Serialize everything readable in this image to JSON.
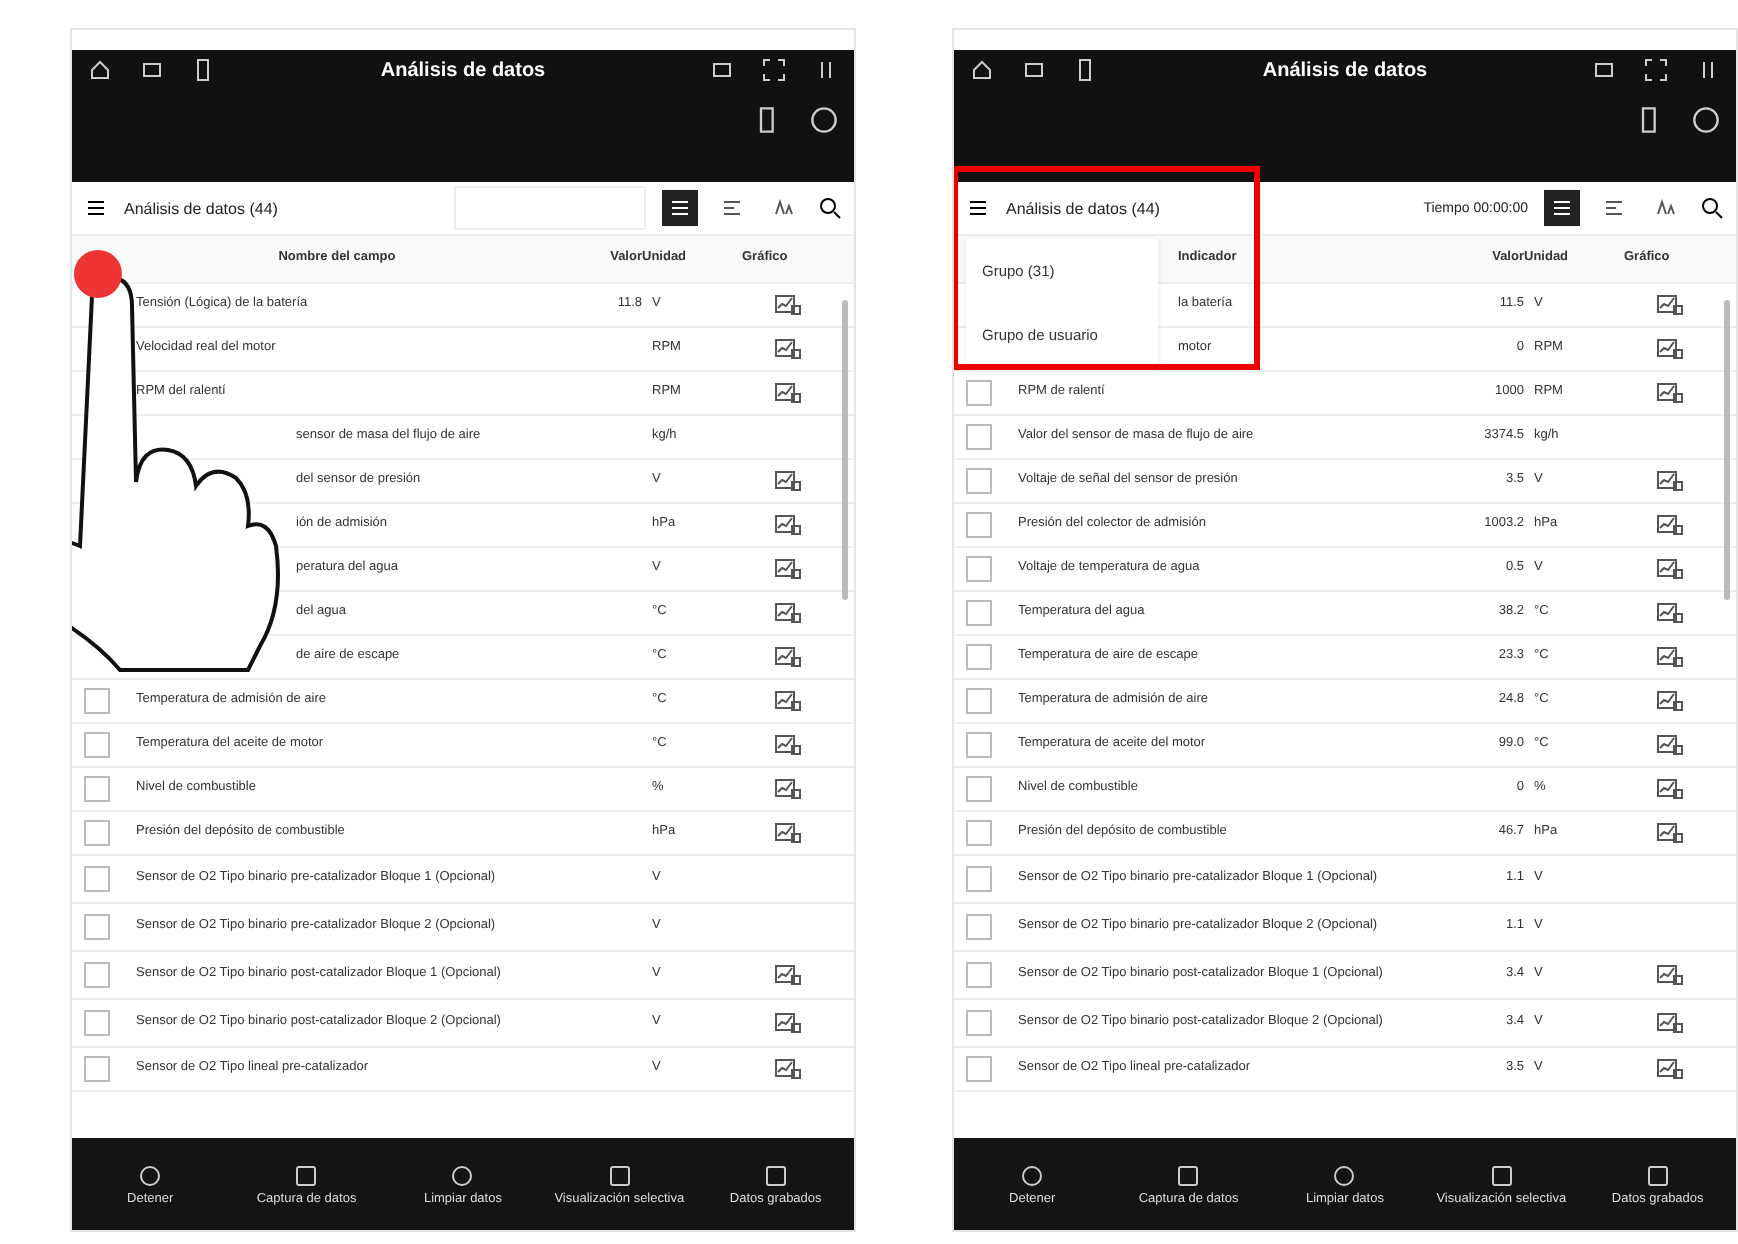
{
  "screens": [
    {
      "title": "Análisis de datos",
      "hand": true,
      "toolbar": {
        "label": "Análisis de datos (44)"
      },
      "columns": [
        "Nombre del campo",
        "Valor",
        "Unidad",
        "Gráfico"
      ],
      "rows": [
        {
          "name": "Tensión (Lógica) de la batería",
          "value": "11.8",
          "unit": "V",
          "graph": true
        },
        {
          "name": "Velocidad real del motor",
          "value": "",
          "unit": "RPM",
          "graph": true
        },
        {
          "name": "RPM del ralentí",
          "value": "",
          "unit": "RPM",
          "graph": true
        },
        {
          "name": "sensor de masa del flujo de aire",
          "value": "",
          "unit": "kg/h",
          "graph": false
        },
        {
          "name": "del sensor de presión",
          "value": "",
          "unit": "V",
          "graph": true
        },
        {
          "name": "ión de admisión",
          "value": "",
          "unit": "hPa",
          "graph": true
        },
        {
          "name": "peratura del agua",
          "value": "",
          "unit": "V",
          "graph": true
        },
        {
          "name": "del agua",
          "value": "",
          "unit": "°C",
          "graph": true
        },
        {
          "name": "de aire de escape",
          "value": "",
          "unit": "°C",
          "graph": true
        },
        {
          "name": "Temperatura de admisión de aire",
          "value": "",
          "unit": "°C",
          "graph": true,
          "checked": false
        },
        {
          "name": "Temperatura del aceite de motor",
          "value": "",
          "unit": "°C",
          "graph": true,
          "checked": false
        },
        {
          "name": "Nivel de combustible",
          "value": "",
          "unit": "%",
          "graph": true,
          "checked": false
        },
        {
          "name": "Presión del depósito de combustible",
          "value": "",
          "unit": "hPa",
          "graph": true,
          "checked": false
        },
        {
          "name": "Sensor de O2 Tipo binario pre-catalizador Bloque 1 (Opcional)",
          "value": "",
          "unit": "V",
          "graph": false,
          "checked": false
        },
        {
          "name": "Sensor de O2 Tipo binario pre-catalizador Bloque 2 (Opcional)",
          "value": "",
          "unit": "V",
          "graph": false,
          "checked": false
        },
        {
          "name": "Sensor de O2 Tipo binario post-catalizador Bloque 1 (Opcional)",
          "value": "",
          "unit": "V",
          "graph": true,
          "checked": false
        },
        {
          "name": "Sensor de O2 Tipo binario post-catalizador Bloque 2 (Opcional)",
          "value": "",
          "unit": "V",
          "graph": true,
          "checked": false
        },
        {
          "name": "Sensor de O2 Tipo lineal pre-catalizador",
          "value": "",
          "unit": "V",
          "graph": true,
          "checked": false
        }
      ],
      "buttons": [
        "Detener",
        "Captura de datos",
        "Limpiar datos",
        "Visualización selectiva",
        "Datos grabados"
      ]
    },
    {
      "title": "Análisis de datos",
      "hand": false,
      "toolbar": {
        "label": "Análisis de datos (44)",
        "time": "Tiempo 00:00:00"
      },
      "group_menu": {
        "items": [
          "Grupo (31)",
          "Grupo de usuario"
        ],
        "highlighted": true
      },
      "columns": [
        "Indicador",
        "Valor",
        "Unidad",
        "Gráfico"
      ],
      "rows": [
        {
          "name": "la batería",
          "value": "11.5",
          "unit": "V",
          "graph": true
        },
        {
          "name": "motor",
          "value": "0",
          "unit": "RPM",
          "graph": true
        },
        {
          "name": "RPM de ralentí",
          "value": "1000",
          "unit": "RPM",
          "graph": true,
          "checked": false
        },
        {
          "name": "Valor del sensor de masa de flujo de aire",
          "value": "3374.5",
          "unit": "kg/h",
          "graph": false,
          "checked": false
        },
        {
          "name": "Voltaje de señal del sensor de presión",
          "value": "3.5",
          "unit": "V",
          "graph": true,
          "checked": false
        },
        {
          "name": "Presión del colector de admisión",
          "value": "1003.2",
          "unit": "hPa",
          "graph": true,
          "checked": false
        },
        {
          "name": "Voltaje de temperatura de agua",
          "value": "0.5",
          "unit": "V",
          "graph": true,
          "checked": false
        },
        {
          "name": "Temperatura del agua",
          "value": "38.2",
          "unit": "°C",
          "graph": true,
          "checked": false
        },
        {
          "name": "Temperatura de aire de escape",
          "value": "23.3",
          "unit": "°C",
          "graph": true,
          "checked": false
        },
        {
          "name": "Temperatura de admisión de aire",
          "value": "24.8",
          "unit": "°C",
          "graph": true,
          "checked": false
        },
        {
          "name": "Temperatura de aceite del motor",
          "value": "99.0",
          "unit": "°C",
          "graph": true,
          "checked": false
        },
        {
          "name": "Nivel de combustible",
          "value": "0",
          "unit": "%",
          "graph": true,
          "checked": false
        },
        {
          "name": "Presión del depósito de combustible",
          "value": "46.7",
          "unit": "hPa",
          "graph": true,
          "checked": false
        },
        {
          "name": "Sensor de O2 Tipo binario pre-catalizador Bloque 1 (Opcional)",
          "value": "1.1",
          "unit": "V",
          "graph": false,
          "checked": false
        },
        {
          "name": "Sensor de O2 Tipo binario pre-catalizador Bloque 2 (Opcional)",
          "value": "1.1",
          "unit": "V",
          "graph": false,
          "checked": false
        },
        {
          "name": "Sensor de O2 Tipo binario post-catalizador Bloque 1 (Opcional)",
          "value": "3.4",
          "unit": "V",
          "graph": true,
          "checked": false
        },
        {
          "name": "Sensor de O2 Tipo binario post-catalizador Bloque 2 (Opcional)",
          "value": "3.4",
          "unit": "V",
          "graph": true,
          "checked": false
        },
        {
          "name": "Sensor de O2 Tipo lineal pre-catalizador",
          "value": "3.5",
          "unit": "V",
          "graph": true,
          "checked": false
        }
      ],
      "buttons": [
        "Detener",
        "Captura de datos",
        "Limpiar datos",
        "Visualización selectiva",
        "Datos grabados"
      ]
    }
  ]
}
